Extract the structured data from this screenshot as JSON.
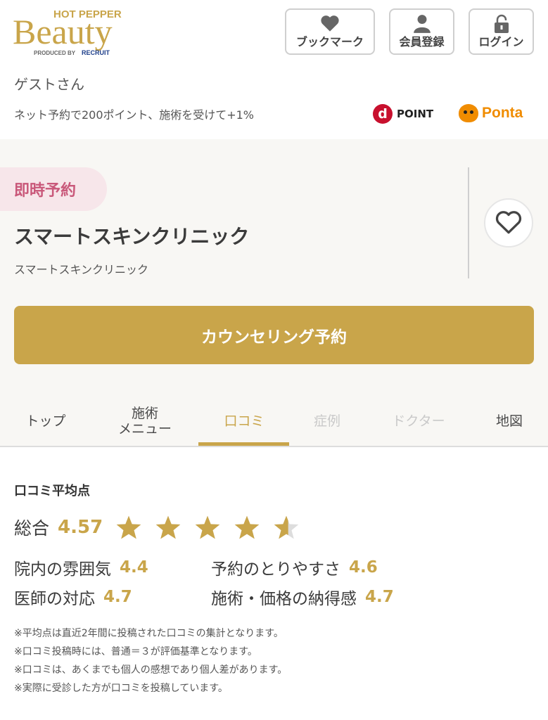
{
  "header": {
    "logo": {
      "top": "HOT PEPPER",
      "main": "Beauty",
      "produced_by": "PRODUCED BY",
      "brand": "RECRUIT"
    },
    "bookmark_label": "ブックマーク",
    "register_label": "会員登録",
    "login_label": "ログイン"
  },
  "guest_label": "ゲストさん",
  "points": {
    "text": "ネット予約で200ポイント、施術を受けて+1%",
    "dpoint_mark": "d",
    "dpoint_label": "POINT",
    "ponta_label": "Ponta"
  },
  "salon": {
    "badge": "即時予約",
    "name": "スマートスキンクリニック",
    "sub_name": "スマートスキンクリニック",
    "cta_label": "カウンセリング予約"
  },
  "tabs": [
    {
      "label": "トップ",
      "state": "normal"
    },
    {
      "label": "施術\nメニュー",
      "state": "normal"
    },
    {
      "label": "口コミ",
      "state": "active"
    },
    {
      "label": "症例",
      "state": "disabled"
    },
    {
      "label": "ドクター",
      "state": "disabled"
    },
    {
      "label": "地図",
      "state": "normal"
    }
  ],
  "reviews": {
    "heading": "口コミ平均点",
    "overall_label": "総合",
    "overall_score": "4.57",
    "overall_rating": 4.57,
    "scores": [
      {
        "label": "院内の雰囲気",
        "value": "4.4"
      },
      {
        "label": "予約のとりやすさ",
        "value": "4.6"
      },
      {
        "label": "医師の対応",
        "value": "4.7"
      },
      {
        "label": "施術・価格の納得感",
        "value": "4.7"
      }
    ],
    "notes": [
      "※平均点は直近2年間に投稿された口コミの集計となります。",
      "※口コミ投稿時には、普通＝３が評価基準となります。",
      "※口コミは、あくまでも個人の感想であり個人差があります。",
      "※実際に受診した方が口コミを投稿しています。"
    ]
  },
  "colors": {
    "accent": "#c9a54a",
    "badge_bg": "#f7e6ea",
    "badge_text": "#c9587a",
    "panel_bg": "#f8f7f4",
    "dpoint_red": "#c8102e",
    "ponta_orange": "#f08c00"
  }
}
